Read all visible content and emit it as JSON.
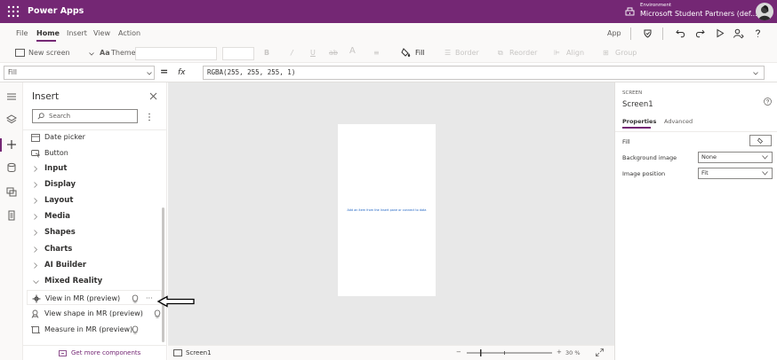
{
  "app": {
    "title": "Power Apps",
    "env_label": "Environment",
    "env_value": "Microsoft Student Partners (def...",
    "brand_color": "#742774"
  },
  "menu": {
    "items": [
      "File",
      "Home",
      "Insert",
      "View",
      "Action"
    ],
    "active": "Home",
    "app_label": "App"
  },
  "toolbar": {
    "new_screen": "New screen",
    "theme": "Theme",
    "fill": "Fill",
    "border": "Border",
    "reorder": "Reorder",
    "align": "Align",
    "group": "Group"
  },
  "formula": {
    "property": "Fill",
    "eq": "=",
    "fx": "fx",
    "expression": "RGBA(255, 255, 255, 1)"
  },
  "insert": {
    "title": "Insert",
    "search_placeholder": "Search",
    "items": [
      {
        "label": "Date picker",
        "kind": "control",
        "icon": "calendar-icon"
      },
      {
        "label": "Button",
        "kind": "control",
        "icon": "button-icon"
      },
      {
        "label": "Input",
        "kind": "category"
      },
      {
        "label": "Display",
        "kind": "category"
      },
      {
        "label": "Layout",
        "kind": "category"
      },
      {
        "label": "Media",
        "kind": "category"
      },
      {
        "label": "Shapes",
        "kind": "category"
      },
      {
        "label": "Charts",
        "kind": "category"
      },
      {
        "label": "AI Builder",
        "kind": "category"
      },
      {
        "label": "Mixed Reality",
        "kind": "category-open"
      },
      {
        "label": "View in MR (preview)",
        "kind": "sub",
        "icon": "mr-view-icon"
      },
      {
        "label": "View shape in MR (preview)",
        "kind": "sub",
        "icon": "mr-shape-icon"
      },
      {
        "label": "Measure in MR (preview)",
        "kind": "sub",
        "icon": "mr-measure-icon"
      }
    ],
    "more_dots": "···",
    "footer": "Get more components"
  },
  "canvas": {
    "hint": "Add an item from the Insert pane or connect to data"
  },
  "status": {
    "screen": "Screen1",
    "zoom": "30 %",
    "zoom_minus": "−",
    "zoom_plus": "+"
  },
  "properties": {
    "type": "SCREEN",
    "name": "Screen1",
    "tabs": [
      "Properties",
      "Advanced"
    ],
    "fill_label": "Fill",
    "bg_label": "Background image",
    "bg_value": "None",
    "pos_label": "Image position",
    "pos_value": "Fit"
  }
}
